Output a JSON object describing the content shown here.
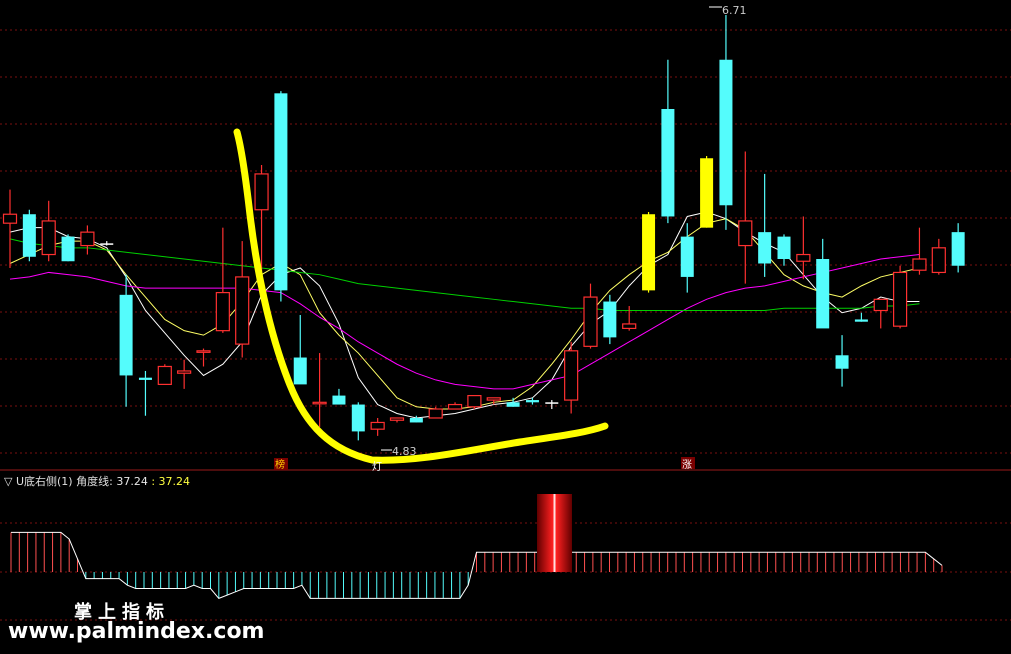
{
  "indicator": {
    "name": "U底右侧(1)",
    "line_label": "角度线:",
    "value1": "37.24",
    "value2": ": 37.24"
  },
  "markers": {
    "low": "4.83",
    "high": "6.71",
    "tag_left": "榜",
    "tag_bottom": "灯",
    "tag_right": "涨"
  },
  "watermark": {
    "cn": "掌上指标",
    "url": "www.palmindex.com"
  },
  "colors": {
    "up": "#ff3030",
    "down": "#54fcfc",
    "yellow": "#ffff00",
    "ma_white": "#ffffff",
    "ma_yellow": "#ffff66",
    "ma_magenta": "#ff00ff",
    "ma_green": "#00d000",
    "grid": "#7a1010",
    "indicator_pos": "#ff5050",
    "indicator_neg": "#54fcfc"
  },
  "chart_data": [
    {
      "type": "candlestick",
      "y_axis": "price",
      "low_label": 4.83,
      "high_label": 6.71,
      "candles": [
        {
          "x": 1,
          "o": 5.78,
          "h": 5.93,
          "l": 5.58,
          "c": 5.82,
          "color": "up"
        },
        {
          "x": 2,
          "o": 5.82,
          "h": 5.84,
          "l": 5.61,
          "c": 5.63,
          "color": "down"
        },
        {
          "x": 3,
          "o": 5.64,
          "h": 5.88,
          "l": 5.61,
          "c": 5.79,
          "color": "up"
        },
        {
          "x": 4,
          "o": 5.72,
          "h": 5.73,
          "l": 5.61,
          "c": 5.61,
          "color": "down"
        },
        {
          "x": 5,
          "o": 5.68,
          "h": 5.77,
          "l": 5.64,
          "c": 5.74,
          "color": "up"
        },
        {
          "x": 6,
          "o": 5.69,
          "h": 5.7,
          "l": 5.68,
          "c": 5.69,
          "color": "flat"
        },
        {
          "x": 7,
          "o": 5.46,
          "h": 5.55,
          "l": 4.96,
          "c": 5.1,
          "color": "down"
        },
        {
          "x": 8,
          "o": 5.09,
          "h": 5.12,
          "l": 4.92,
          "c": 5.08,
          "color": "down"
        },
        {
          "x": 9,
          "o": 5.06,
          "h": 5.15,
          "l": 5.06,
          "c": 5.14,
          "color": "up"
        },
        {
          "x": 10,
          "o": 5.11,
          "h": 5.17,
          "l": 5.04,
          "c": 5.12,
          "color": "up"
        },
        {
          "x": 11,
          "o": 5.21,
          "h": 5.22,
          "l": 5.14,
          "c": 5.21,
          "color": "up"
        },
        {
          "x": 12,
          "o": 5.3,
          "h": 5.76,
          "l": 5.29,
          "c": 5.47,
          "color": "up"
        },
        {
          "x": 13,
          "o": 5.24,
          "h": 5.7,
          "l": 5.18,
          "c": 5.54,
          "color": "up"
        },
        {
          "x": 14,
          "o": 5.84,
          "h": 6.04,
          "l": 5.46,
          "c": 6.0,
          "color": "up"
        },
        {
          "x": 15,
          "o": 6.36,
          "h": 6.37,
          "l": 5.43,
          "c": 5.48,
          "color": "down"
        },
        {
          "x": 16,
          "o": 5.18,
          "h": 5.37,
          "l": 5.07,
          "c": 5.06,
          "color": "down"
        },
        {
          "x": 17,
          "o": 4.98,
          "h": 5.2,
          "l": 4.87,
          "c": 4.98,
          "color": "up"
        },
        {
          "x": 18,
          "o": 5.01,
          "h": 5.04,
          "l": 4.99,
          "c": 4.97,
          "color": "down"
        },
        {
          "x": 19,
          "o": 4.97,
          "h": 4.98,
          "l": 4.81,
          "c": 4.85,
          "color": "down"
        },
        {
          "x": 20,
          "o": 4.86,
          "h": 4.91,
          "l": 4.83,
          "c": 4.89,
          "color": "up"
        },
        {
          "x": 21,
          "o": 4.9,
          "h": 4.9,
          "l": 4.89,
          "c": 4.91,
          "color": "up"
        },
        {
          "x": 22,
          "o": 4.91,
          "h": 4.92,
          "l": 4.89,
          "c": 4.89,
          "color": "down"
        },
        {
          "x": 23,
          "o": 4.91,
          "h": 4.96,
          "l": 4.91,
          "c": 4.95,
          "color": "up"
        },
        {
          "x": 24,
          "o": 4.95,
          "h": 4.98,
          "l": 4.95,
          "c": 4.97,
          "color": "up"
        },
        {
          "x": 25,
          "o": 4.96,
          "h": 5.01,
          "l": 4.95,
          "c": 5.01,
          "color": "up"
        },
        {
          "x": 26,
          "o": 5.0,
          "h": 5.0,
          "l": 4.97,
          "c": 4.99,
          "color": "up"
        },
        {
          "x": 27,
          "o": 4.98,
          "h": 5.0,
          "l": 4.96,
          "c": 4.96,
          "color": "down"
        },
        {
          "x": 28,
          "o": 4.99,
          "h": 5.0,
          "l": 4.97,
          "c": 4.98,
          "color": "down"
        },
        {
          "x": 29,
          "o": 4.98,
          "h": 4.99,
          "l": 4.95,
          "c": 4.98,
          "color": "flat"
        },
        {
          "x": 30,
          "o": 4.99,
          "h": 5.25,
          "l": 4.93,
          "c": 5.21,
          "color": "up"
        },
        {
          "x": 31,
          "o": 5.23,
          "h": 5.51,
          "l": 5.22,
          "c": 5.45,
          "color": "up"
        },
        {
          "x": 32,
          "o": 5.43,
          "h": 5.46,
          "l": 5.24,
          "c": 5.27,
          "color": "down"
        },
        {
          "x": 33,
          "o": 5.31,
          "h": 5.41,
          "l": 5.3,
          "c": 5.33,
          "color": "up"
        },
        {
          "x": 34,
          "o": 5.48,
          "h": 5.83,
          "l": 5.47,
          "c": 5.82,
          "color": "yellow"
        },
        {
          "x": 35,
          "o": 6.29,
          "h": 6.51,
          "l": 5.78,
          "c": 5.81,
          "color": "down"
        },
        {
          "x": 36,
          "o": 5.72,
          "h": 5.78,
          "l": 5.47,
          "c": 5.54,
          "color": "down"
        },
        {
          "x": 37,
          "o": 6.07,
          "h": 6.08,
          "l": 5.76,
          "c": 5.76,
          "color": "yellow"
        },
        {
          "x": 38,
          "o": 6.51,
          "h": 6.71,
          "l": 5.75,
          "c": 5.86,
          "color": "down"
        },
        {
          "x": 39,
          "o": 5.79,
          "h": 6.1,
          "l": 5.51,
          "c": 5.68,
          "color": "up"
        },
        {
          "x": 40,
          "o": 5.74,
          "h": 6.0,
          "l": 5.54,
          "c": 5.6,
          "color": "down"
        },
        {
          "x": 41,
          "o": 5.72,
          "h": 5.73,
          "l": 5.59,
          "c": 5.62,
          "color": "down"
        },
        {
          "x": 42,
          "o": 5.61,
          "h": 5.81,
          "l": 5.53,
          "c": 5.64,
          "color": "up"
        },
        {
          "x": 43,
          "o": 5.62,
          "h": 5.71,
          "l": 5.34,
          "c": 5.31,
          "color": "down"
        },
        {
          "x": 44,
          "o": 5.19,
          "h": 5.28,
          "l": 5.05,
          "c": 5.13,
          "color": "down"
        },
        {
          "x": 45,
          "o": 5.34,
          "h": 5.38,
          "l": 5.34,
          "c": 5.35,
          "color": "down"
        },
        {
          "x": 46,
          "o": 5.39,
          "h": 5.43,
          "l": 5.31,
          "c": 5.44,
          "color": "up"
        },
        {
          "x": 47,
          "o": 5.32,
          "h": 5.59,
          "l": 5.31,
          "c": 5.56,
          "color": "up"
        },
        {
          "x": 48,
          "o": 5.57,
          "h": 5.76,
          "l": 5.55,
          "c": 5.62,
          "color": "up"
        },
        {
          "x": 49,
          "o": 5.56,
          "h": 5.71,
          "l": 5.55,
          "c": 5.67,
          "color": "up"
        },
        {
          "x": 50,
          "o": 5.74,
          "h": 5.78,
          "l": 5.56,
          "c": 5.59,
          "color": "down"
        }
      ],
      "moving_averages": [
        {
          "color": "ma_white",
          "values": [
            5.74,
            5.76,
            5.76,
            5.72,
            5.71,
            5.67,
            5.54,
            5.39,
            5.29,
            5.19,
            5.1,
            5.15,
            5.25,
            5.46,
            5.55,
            5.58,
            5.5,
            5.33,
            5.09,
            4.97,
            4.93,
            4.91,
            4.92,
            4.93,
            4.95,
            4.97,
            4.98,
            5.0,
            5.08,
            5.23,
            5.33,
            5.39,
            5.5,
            5.59,
            5.64,
            5.81,
            5.83,
            5.8,
            5.74,
            5.69,
            5.65,
            5.55,
            5.45,
            5.38,
            5.4,
            5.45,
            5.43,
            5.43
          ]
        },
        {
          "color": "ma_yellow",
          "values": [
            5.6,
            5.64,
            5.68,
            5.7,
            5.7,
            5.66,
            5.55,
            5.45,
            5.35,
            5.3,
            5.28,
            5.33,
            5.43,
            5.55,
            5.6,
            5.55,
            5.38,
            5.28,
            5.2,
            5.1,
            5.0,
            4.96,
            4.95,
            4.95,
            4.96,
            4.98,
            4.99,
            5.05,
            5.15,
            5.26,
            5.38,
            5.48,
            5.55,
            5.61,
            5.65,
            5.72,
            5.78,
            5.8,
            5.75,
            5.65,
            5.55,
            5.5,
            5.47,
            5.45,
            5.5,
            5.54,
            5.56,
            5.58
          ]
        },
        {
          "color": "ma_magenta",
          "values": [
            5.53,
            5.54,
            5.56,
            5.55,
            5.54,
            5.52,
            5.5,
            5.49,
            5.49,
            5.49,
            5.49,
            5.49,
            5.49,
            5.48,
            5.47,
            5.42,
            5.36,
            5.31,
            5.25,
            5.2,
            5.15,
            5.11,
            5.08,
            5.06,
            5.05,
            5.04,
            5.04,
            5.06,
            5.08,
            5.1,
            5.15,
            5.2,
            5.25,
            5.3,
            5.35,
            5.4,
            5.44,
            5.47,
            5.49,
            5.5,
            5.52,
            5.54,
            5.56,
            5.58,
            5.6,
            5.62,
            5.63,
            5.64
          ]
        },
        {
          "color": "ma_green",
          "values": [
            5.71,
            5.69,
            5.68,
            5.67,
            5.67,
            5.66,
            5.65,
            5.64,
            5.63,
            5.62,
            5.61,
            5.6,
            5.59,
            5.58,
            5.57,
            5.56,
            5.55,
            5.53,
            5.51,
            5.5,
            5.49,
            5.48,
            5.47,
            5.46,
            5.45,
            5.44,
            5.43,
            5.42,
            5.41,
            5.4,
            5.4,
            5.39,
            5.39,
            5.39,
            5.39,
            5.39,
            5.39,
            5.39,
            5.39,
            5.39,
            5.4,
            5.4,
            5.4,
            5.4,
            5.4,
            5.41,
            5.41,
            5.42
          ]
        }
      ]
    },
    {
      "type": "bar",
      "name": "U底右侧(1)",
      "series_label": "角度线",
      "last_value": 37.24,
      "highlight_bar": 28,
      "values": [
        60,
        60,
        60,
        60,
        60,
        60,
        60,
        50,
        20,
        -10,
        -10,
        -10,
        -10,
        -10,
        -20,
        -25,
        -25,
        -25,
        -25,
        -25,
        -25,
        -25,
        -20,
        -25,
        -25,
        -40,
        -35,
        -30,
        -25,
        -25,
        -25,
        -25,
        -25,
        -25,
        -25,
        -20,
        -40,
        -40,
        -40,
        -40,
        -40,
        -40,
        -40,
        -40,
        -40,
        -40,
        -40,
        -40,
        -40,
        -40,
        -40,
        -40,
        -40,
        -40,
        -40,
        -20,
        30,
        30,
        30,
        30,
        30,
        30,
        30,
        30,
        30,
        30,
        30,
        30,
        30,
        30,
        30,
        30,
        30,
        30,
        30,
        30,
        30,
        30,
        30,
        30,
        30,
        30,
        30,
        30,
        30,
        30,
        30,
        30,
        30,
        30,
        30,
        30,
        30,
        30,
        30,
        30,
        30,
        30,
        30,
        30,
        30,
        30,
        30,
        30,
        30,
        30,
        30,
        30,
        30,
        30,
        30,
        20,
        10
      ]
    }
  ]
}
